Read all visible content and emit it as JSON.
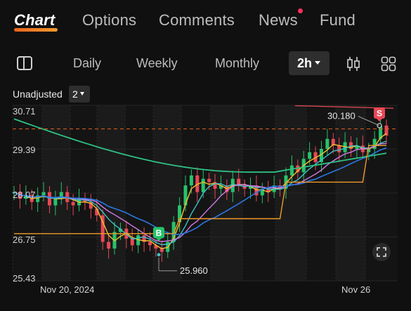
{
  "top_tabs": [
    {
      "label": "Chart",
      "active": true
    },
    {
      "label": "Options",
      "active": false
    },
    {
      "label": "Comments",
      "active": false
    },
    {
      "label": "News",
      "active": false,
      "badge": "red-dot"
    },
    {
      "label": "Fund",
      "active": false
    }
  ],
  "periods": {
    "daily": "Daily",
    "weekly": "Weekly",
    "monthly": "Monthly",
    "selected": "2h"
  },
  "adjustment": {
    "label": "Unadjusted",
    "value": "2"
  },
  "icons": {
    "sidebar": "sidebar-toggle-icon",
    "candle": "candlestick-icon",
    "grid": "grid-layout-icon",
    "fullscreen": "fullscreen-icon"
  },
  "colors": {
    "accent": "#e8641c",
    "up": "#27c26b",
    "down": "#e84855",
    "ma_green": "#2fc184",
    "ma_blue": "#2a78e6",
    "ma_purple": "#d17be6",
    "ma_yellow": "#f2c230",
    "ma_orange": "#f29a2a",
    "ma_cyan": "#3bc3c8"
  },
  "chart_data": {
    "type": "candlestick",
    "price_axis": [
      "30.71",
      "29.39",
      "28.07",
      "26.75",
      "25.43"
    ],
    "ylim": [
      25.43,
      30.71
    ],
    "date_labels": [
      "Nov 20, 2024",
      "Nov 26"
    ],
    "current_price_line": 30.0,
    "annotations": {
      "high": "30.180",
      "low": "25.960",
      "buy_marker": "B",
      "sell_marker": "S"
    },
    "close": [
      28.1,
      27.9,
      28.0,
      27.8,
      28.0,
      28.1,
      27.7,
      27.9,
      28.1,
      27.8,
      27.7,
      27.9,
      27.8,
      27.6,
      27.4,
      26.6,
      26.4,
      26.9,
      27.0,
      26.7,
      26.5,
      26.8,
      26.6,
      26.5,
      26.4,
      26.3,
      26.6,
      27.2,
      27.7,
      28.3,
      28.6,
      28.1,
      28.5,
      28.4,
      28.2,
      28.3,
      28.1,
      28.5,
      28.3,
      28.2,
      28.3,
      28.0,
      28.2,
      28.1,
      28.3,
      28.2,
      28.6,
      28.9,
      28.7,
      29.1,
      29.3,
      29.0,
      29.4,
      29.7,
      29.5,
      29.3,
      29.6,
      29.4,
      29.5,
      29.3,
      29.4,
      29.7,
      30.1,
      29.8
    ]
  }
}
